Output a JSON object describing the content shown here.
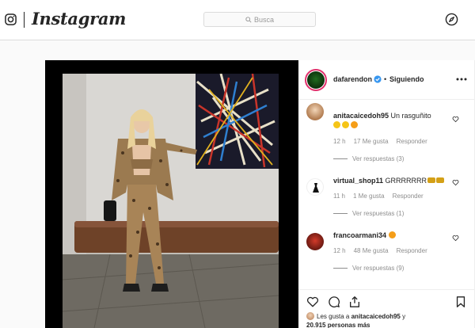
{
  "header": {
    "wordmark": "Instagram",
    "search_placeholder": "Busca"
  },
  "post": {
    "owner": "dafarendon",
    "separator": "•",
    "following_label": "Siguiendo"
  },
  "comments": [
    {
      "user": "anitacaicedoh95",
      "text": "Un rasguñito",
      "age": "12 h",
      "likes": "17 Me gusta",
      "reply": "Responder",
      "view_replies": "Ver respuestas (3)"
    },
    {
      "user": "virtual_shop11",
      "text": "GRRRRRRR",
      "age": "11 h",
      "likes": "1 Me gusta",
      "reply": "Responder",
      "view_replies": "Ver respuestas (1)"
    },
    {
      "user": "francoarmani34",
      "text": "",
      "age": "12 h",
      "likes": "48 Me gusta",
      "reply": "Responder",
      "view_replies": "Ver respuestas (9)"
    }
  ],
  "likes_line": {
    "prefix": "Les gusta a",
    "user": "anitacaicedoh95",
    "middle": "y",
    "count": "20.915 personas más"
  },
  "colors": {
    "verified": "#3897f0",
    "story_ring": "#e1306c"
  }
}
